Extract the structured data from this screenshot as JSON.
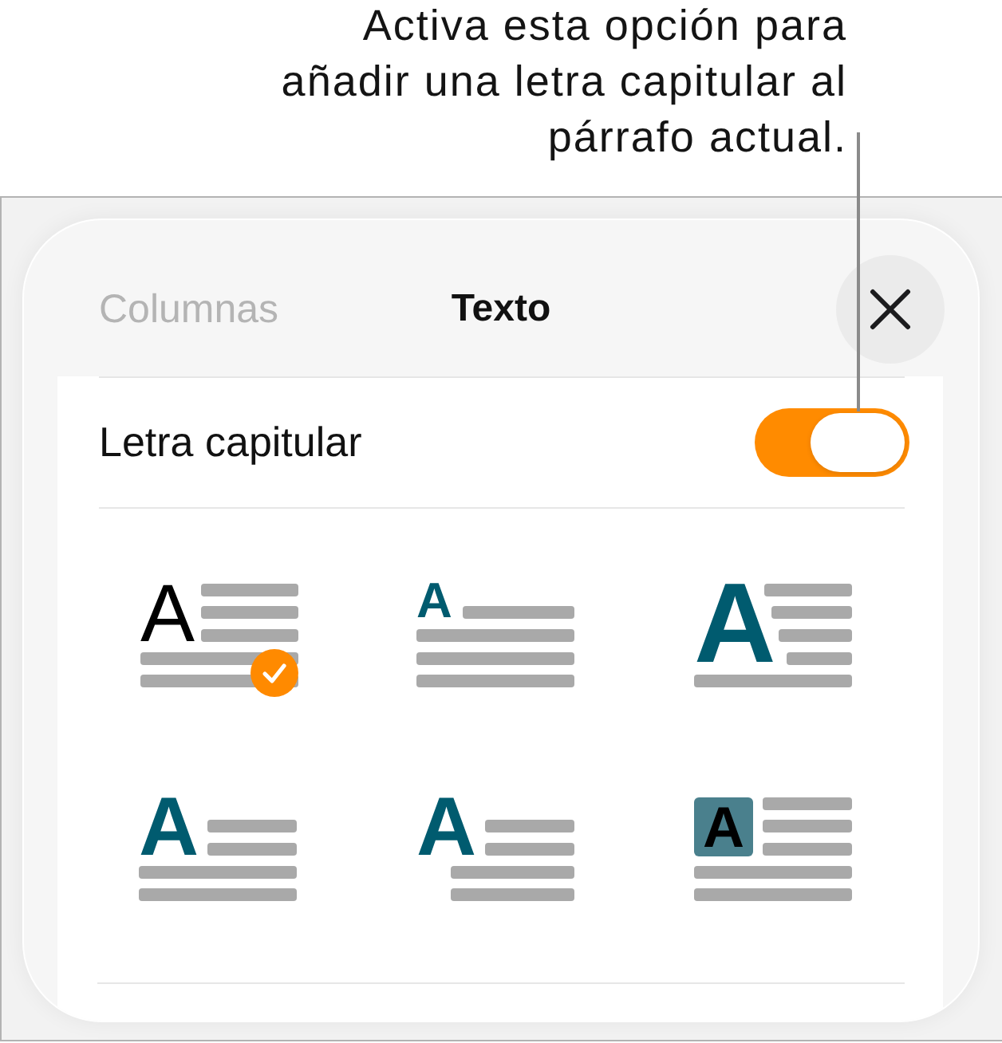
{
  "callout": {
    "text": "Activa esta opción para añadir una letra capitular al párrafo actual."
  },
  "panel": {
    "back_title": "Columnas",
    "title": "Texto"
  },
  "drop_cap": {
    "label": "Letra capitular",
    "on": true
  },
  "styles": [
    {
      "kind": "plain",
      "letter": "A",
      "selected": true
    },
    {
      "kind": "raised",
      "letter": "A",
      "selected": false
    },
    {
      "kind": "tall",
      "letter": "A",
      "selected": false
    },
    {
      "kind": "drop",
      "letter": "A",
      "selected": false
    },
    {
      "kind": "margin",
      "letter": "A",
      "selected": false
    },
    {
      "kind": "boxed",
      "letter": "A",
      "selected": false
    }
  ]
}
